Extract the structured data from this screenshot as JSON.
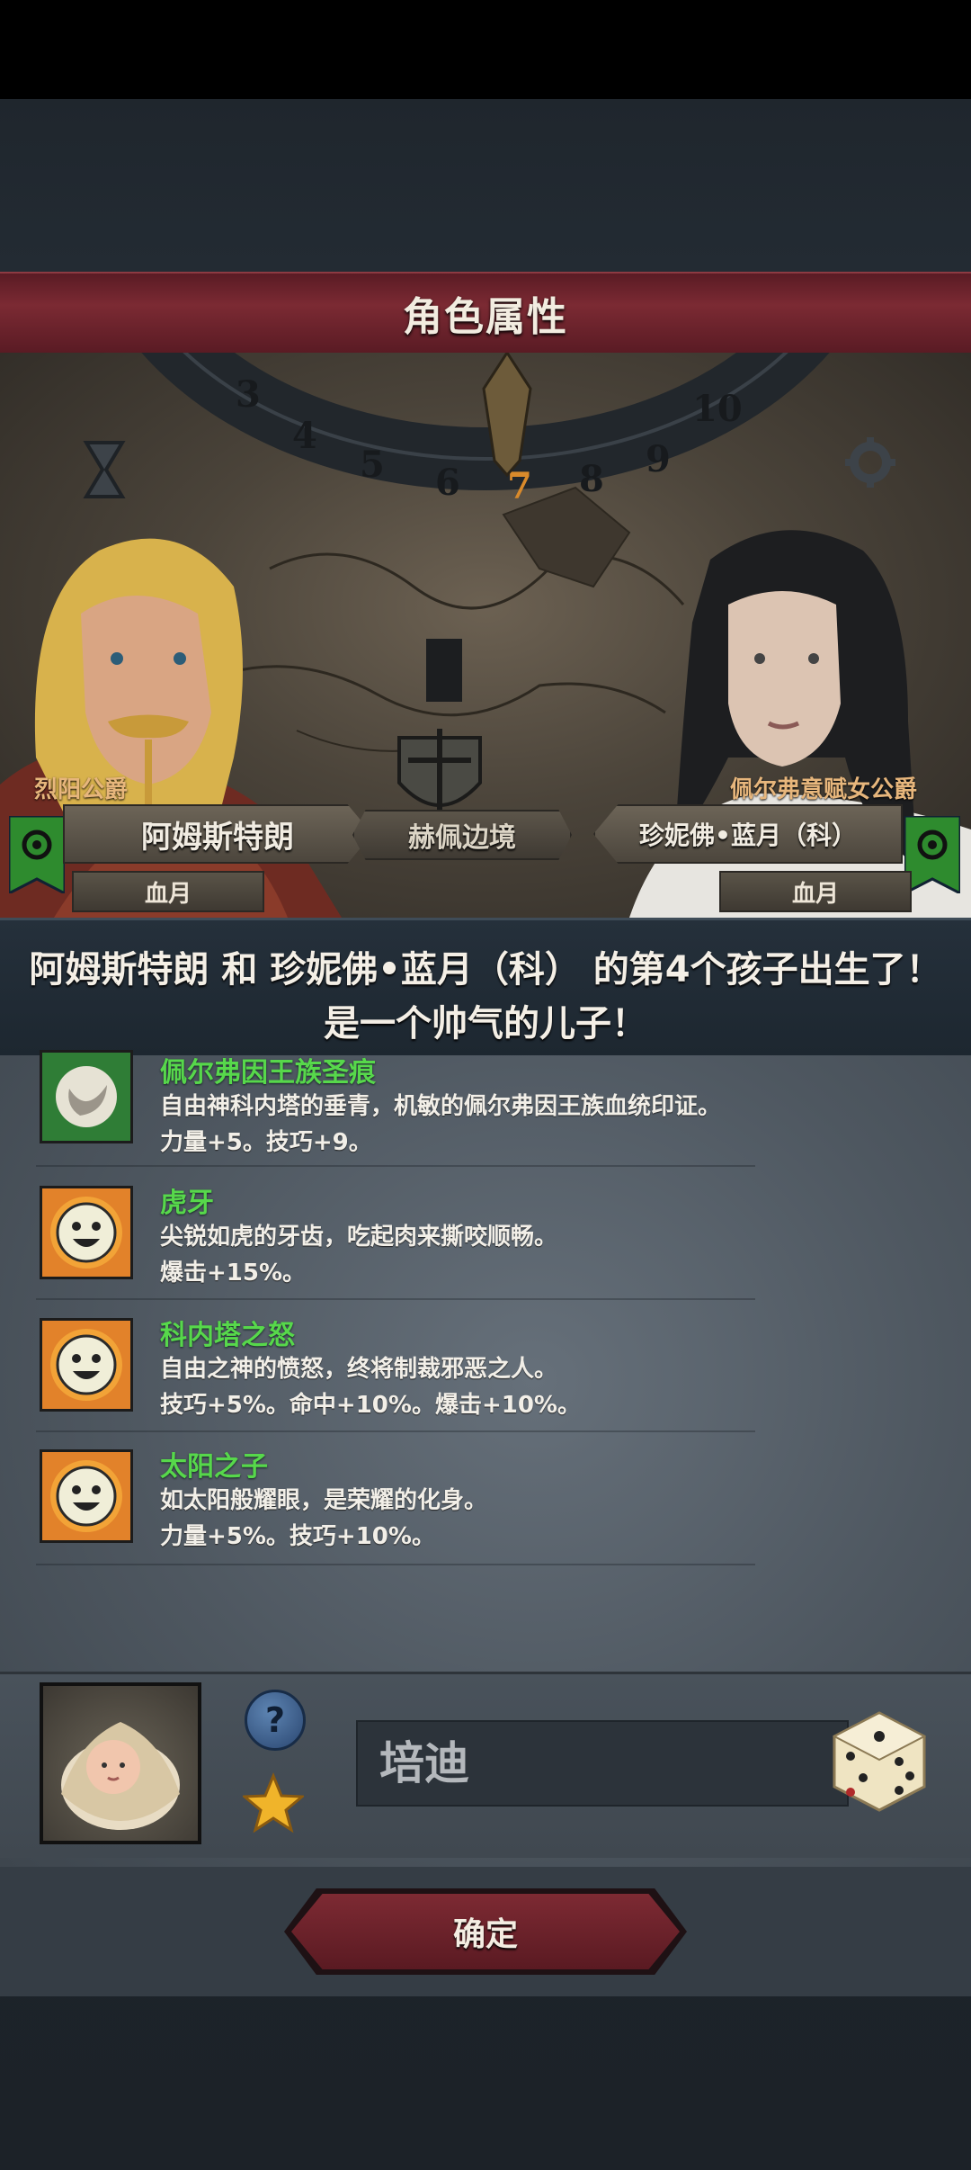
{
  "header": {
    "title": "角色属性"
  },
  "scene": {
    "dial_numbers": [
      "3",
      "4",
      "5",
      "6",
      "7",
      "8",
      "9",
      "10"
    ],
    "dial_current": "7",
    "left": {
      "title": "烈阳公爵",
      "name": "阿姆斯特朗",
      "house": "血月"
    },
    "right": {
      "title": "佩尔弗意赋女公爵",
      "name": "珍妮佛•蓝月（科）",
      "house": "血月"
    },
    "location": "赫佩边境"
  },
  "announcement": {
    "line1": "阿姆斯特朗 和 珍妮佛•蓝月（科） 的第4个孩子出生了！",
    "line2": "是一个帅气的儿子！"
  },
  "traits": [
    {
      "name": "佩尔弗因王族圣痕",
      "desc": "自由神科内塔的垂青，机敏的佩尔弗因王族血统印证。",
      "effect": "力量+5。技巧+9。",
      "icon": "royal-stigmata-icon"
    },
    {
      "name": "虎牙",
      "desc": "尖锐如虎的牙齿，吃起肉来撕咬顺畅。",
      "effect": "爆击+15%。",
      "icon": "sun-face-icon"
    },
    {
      "name": "科内塔之怒",
      "desc": "自由之神的愤怒，终将制裁邪恶之人。",
      "effect": "技巧+5%。命中+10%。爆击+10%。",
      "icon": "sun-face-icon"
    },
    {
      "name": "太阳之子",
      "desc": "如太阳般耀眼，是荣耀的化身。",
      "effect": "力量+5%。技巧+10%。",
      "icon": "sun-face-icon"
    }
  ],
  "child": {
    "name_value": "培迪"
  },
  "buttons": {
    "confirm": "确定",
    "help": "?"
  },
  "colors": {
    "title_bar": "#7b2a33",
    "trait_name": "#57d84b",
    "confirm": "#7d2a33",
    "title_label": "#e7b67c"
  }
}
